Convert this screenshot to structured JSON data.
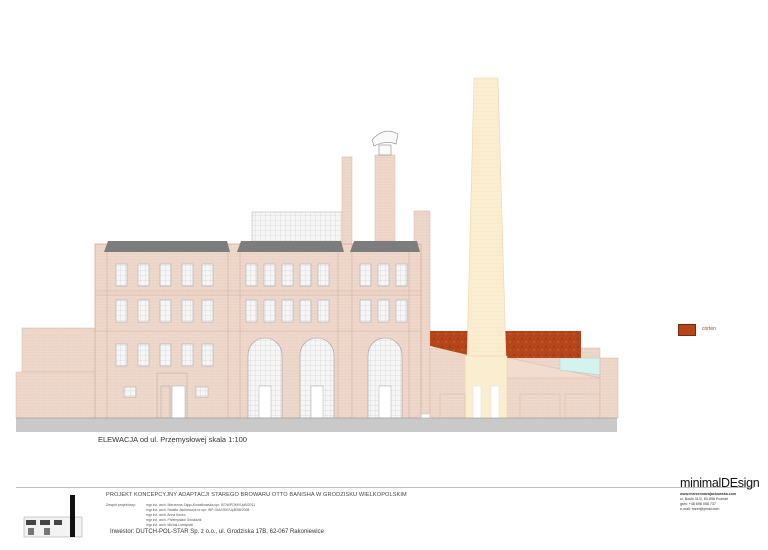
{
  "elevation_title": "ELEWACJA od ul. Przemysłowej  skala 1:100",
  "legend": {
    "label": "corten",
    "color": "#b5461c"
  },
  "project_title": "PROJEKT KONCEPCYJNY ADAPTACJI STAREGO BROWARU OTTO BANISHA W GRODZISKU WIELKOPOLSKIM",
  "team_label": "Zespół projektowy:",
  "team_members": [
    "mgr inż. arch. Marzenna Zając-Kowalkowska upr. 8/7/WPOKK/UpB/2011",
    "mgr inż. arch. Natalia Jachimczyk nr upr. WP-OIA/OKK/UpB/98/2008",
    "mgr inż. arch. Anna Kmiec",
    "mgr inż. arch. Przemysław Gwoździk",
    "mgr inż. arch. Michał Lidmyczki"
  ],
  "investor": "Inwestor:   DUTCH-POL-STAR Sp. z o.o., ul. Grodziska 17B, 62-067 Rakoniewice",
  "logo": "minimalDEsign",
  "contact": {
    "web": "www.marzennazajackowska.com",
    "address": "ul. Bosin 31/3, 60-656 Poznań",
    "phone": "gsm: +48 698 058 737",
    "email": "e-mail: mzet@ymail.com"
  },
  "colors": {
    "brick": "#efd7cb",
    "brick_edge": "#d9b8a6",
    "roof": "#808080",
    "chimney_light": "#fbebc9",
    "corten": "#b5461c",
    "glass": "#d4f2ee",
    "ground": "#c9c9c9"
  },
  "icons": [
    "ventilator-icon",
    "thumbnail-factory-icon"
  ]
}
